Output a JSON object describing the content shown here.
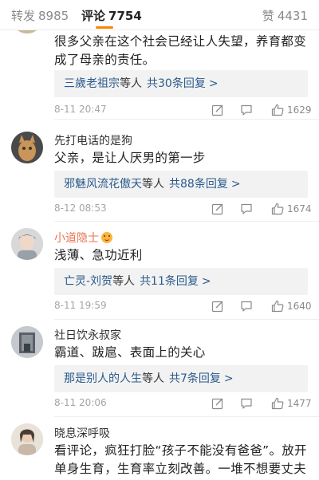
{
  "tabs": {
    "forward": {
      "label": "转发",
      "count": "8985"
    },
    "comment": {
      "label": "评论",
      "count": "7754"
    },
    "like": {
      "label": "赞",
      "count": "4431"
    }
  },
  "accent_color": "#ff8200",
  "link_color": "#2a5b8c",
  "comments": [
    {
      "username": "",
      "text": "很多父亲在这个社会已经让人失望，养育都变成了母亲的责任。",
      "reply": {
        "names": "三歲老祖宗",
        "suffix": "等人",
        "count_text": "共30条回复",
        "chevron": ">"
      },
      "time": "8-11 20:47",
      "likes": "1629"
    },
    {
      "username": "先打电话的是狗",
      "text": "父亲，是让人厌男的第一步",
      "reply": {
        "names": "邪魅风流花傲天",
        "suffix": "等人",
        "count_text": "共88条回复",
        "chevron": ">"
      },
      "time": "8-12 08:53",
      "likes": "1674"
    },
    {
      "username": "小道隐士",
      "badge": "smile-emoji-icon",
      "text": "浅薄、急功近利",
      "reply": {
        "names": "亡灵-刘贺",
        "suffix": "等人",
        "count_text": "共11条回复",
        "chevron": ">"
      },
      "time": "8-11 19:59",
      "likes": "1640"
    },
    {
      "username": "社日饮永叔家",
      "text": "霸道、跋扈、表面上的关心",
      "reply": {
        "names": "那是别人的人生",
        "suffix": "等人",
        "count_text": "共7条回复",
        "chevron": ">"
      },
      "time": "8-11 20:06",
      "likes": "1477"
    },
    {
      "username": "晓息深呼吸",
      "text": "看评论，疯狂打脸“孩子不能没有爸爸”。放开单身生育，生育率立刻改善。一堆不想要丈夫的富婆想要孩子"
    }
  ]
}
